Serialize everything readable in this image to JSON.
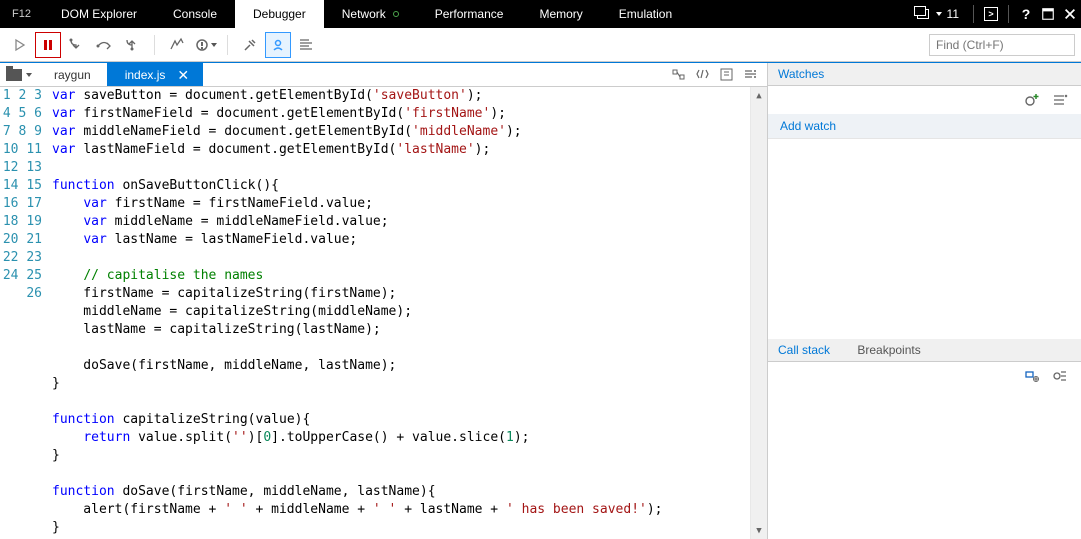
{
  "header": {
    "f12": "F12",
    "tabs": [
      "DOM Explorer",
      "Console",
      "Debugger",
      "Network",
      "Performance",
      "Memory",
      "Emulation"
    ],
    "active_tab": "Debugger",
    "count_badge": "11",
    "search_placeholder": "Find (Ctrl+F)"
  },
  "files": {
    "crumb": "raygun",
    "active": "index.js"
  },
  "watches": {
    "title": "Watches",
    "add_label": "Add watch"
  },
  "callstack": {
    "title": "Call stack",
    "breakpoints": "Breakpoints"
  },
  "code": {
    "lines": [
      [
        {
          "t": "var ",
          "c": "kw"
        },
        {
          "t": "saveButton = document.getElementById("
        },
        {
          "t": "'saveButton'",
          "c": "str"
        },
        {
          "t": ");"
        }
      ],
      [
        {
          "t": "var ",
          "c": "kw"
        },
        {
          "t": "firstNameField = document.getElementById("
        },
        {
          "t": "'firstName'",
          "c": "str"
        },
        {
          "t": ");"
        }
      ],
      [
        {
          "t": "var ",
          "c": "kw"
        },
        {
          "t": "middleNameField = document.getElementById("
        },
        {
          "t": "'middleName'",
          "c": "str"
        },
        {
          "t": ");"
        }
      ],
      [
        {
          "t": "var ",
          "c": "kw"
        },
        {
          "t": "lastNameField = document.getElementById("
        },
        {
          "t": "'lastName'",
          "c": "str"
        },
        {
          "t": ");"
        }
      ],
      [
        {
          "t": ""
        }
      ],
      [
        {
          "t": "function ",
          "c": "kw"
        },
        {
          "t": "onSaveButtonClick(){"
        }
      ],
      [
        {
          "t": "    "
        },
        {
          "t": "var ",
          "c": "kw"
        },
        {
          "t": "firstName = firstNameField.value;"
        }
      ],
      [
        {
          "t": "    "
        },
        {
          "t": "var ",
          "c": "kw"
        },
        {
          "t": "middleName = middleNameField.value;"
        }
      ],
      [
        {
          "t": "    "
        },
        {
          "t": "var ",
          "c": "kw"
        },
        {
          "t": "lastName = lastNameField.value;"
        }
      ],
      [
        {
          "t": ""
        }
      ],
      [
        {
          "t": "    "
        },
        {
          "t": "// capitalise the names",
          "c": "cmt"
        }
      ],
      [
        {
          "t": "    firstName = capitalizeString(firstName);"
        }
      ],
      [
        {
          "t": "    middleName = capitalizeString(middleName);"
        }
      ],
      [
        {
          "t": "    lastName = capitalizeString(lastName);"
        }
      ],
      [
        {
          "t": ""
        }
      ],
      [
        {
          "t": "    doSave(firstName, middleName, lastName);"
        }
      ],
      [
        {
          "t": "}"
        }
      ],
      [
        {
          "t": ""
        }
      ],
      [
        {
          "t": "function ",
          "c": "kw"
        },
        {
          "t": "capitalizeString(value){"
        }
      ],
      [
        {
          "t": "    "
        },
        {
          "t": "return ",
          "c": "kw"
        },
        {
          "t": "value.split("
        },
        {
          "t": "''",
          "c": "str"
        },
        {
          "t": ")["
        },
        {
          "t": "0",
          "c": "num"
        },
        {
          "t": "].toUpperCase() + value.slice("
        },
        {
          "t": "1",
          "c": "num"
        },
        {
          "t": ");"
        }
      ],
      [
        {
          "t": "}"
        }
      ],
      [
        {
          "t": ""
        }
      ],
      [
        {
          "t": "function ",
          "c": "kw"
        },
        {
          "t": "doSave(firstName, middleName, lastName){"
        }
      ],
      [
        {
          "t": "    alert(firstName + "
        },
        {
          "t": "' '",
          "c": "str"
        },
        {
          "t": " + middleName + "
        },
        {
          "t": "' '",
          "c": "str"
        },
        {
          "t": " + lastName + "
        },
        {
          "t": "' has been saved!'",
          "c": "str"
        },
        {
          "t": ");"
        }
      ],
      [
        {
          "t": "}"
        }
      ],
      [
        {
          "t": ""
        }
      ]
    ]
  }
}
